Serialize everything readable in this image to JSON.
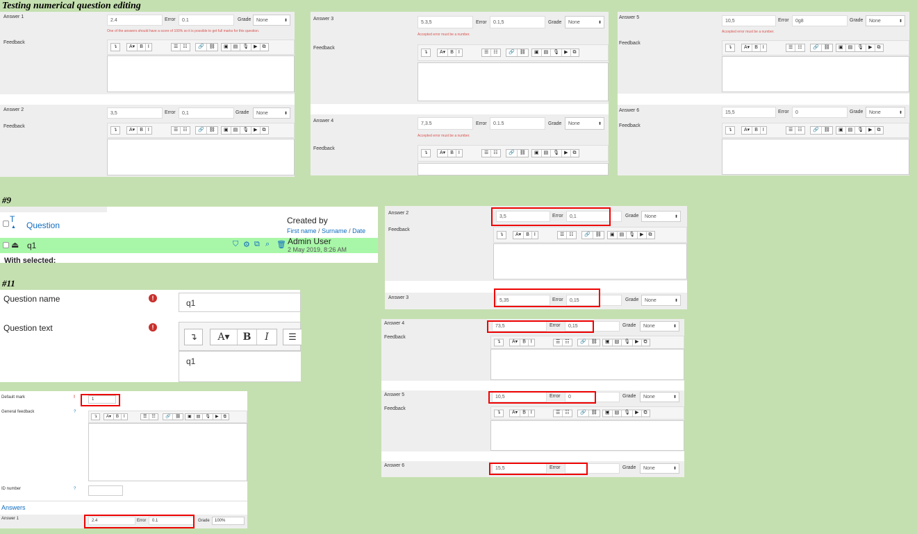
{
  "headings": {
    "main": "Testing numerical question editing",
    "h9": "#9",
    "h11": "#11"
  },
  "field_labels": {
    "error": "Error",
    "grade": "Grade",
    "feedback": "Feedback",
    "grade_none": "None",
    "grade_100": "100%"
  },
  "messages": {
    "score_warning": "One of the answers should have a score of 100% so it is possible to get full marks for this question.",
    "error_number": "Accepted error must be a number."
  },
  "toolbar": {
    "g1": [
      "↴"
    ],
    "g2": [
      "A▾",
      "B",
      "I"
    ],
    "g3": [
      "☰",
      "☷"
    ],
    "g4": [
      "🔗",
      "⛓"
    ],
    "g5": [
      "▣",
      "▤",
      "🎙",
      "▶",
      "⧉"
    ]
  },
  "panel_a": {
    "answer1": {
      "label": "Answer 1",
      "value": "2.4",
      "error": "0.1"
    },
    "answer2": {
      "label": "Answer 2",
      "value": "3,5",
      "error": "0,1"
    }
  },
  "panel_b": {
    "answer3": {
      "label": "Answer 3",
      "value": "5.3,5",
      "error": "0.1,5"
    },
    "answer4": {
      "label": "Answer 4",
      "value": "7,3.5",
      "error": "0.1.5"
    }
  },
  "panel_c": {
    "answer5": {
      "label": "Answer 5",
      "value": "10,5",
      "error": "0g8"
    },
    "answer6": {
      "label": "Answer 6",
      "value": "15,5",
      "error": "0"
    }
  },
  "bank": {
    "col_t": "T",
    "col_question": "Question",
    "created_by": "Created by",
    "created_sub": [
      "First name",
      "Surname",
      "Date"
    ],
    "row": {
      "name": "q1",
      "author": "Admin User",
      "date": "2 May 2019, 8:26 AM"
    },
    "with_selected": "With selected:",
    "action_icons": [
      "tag-icon",
      "gear-icon",
      "duplicate-icon",
      "preview-icon",
      "delete-icon"
    ]
  },
  "form11": {
    "qname_label": "Question name",
    "qname_value": "q1",
    "qtext_label": "Question text",
    "qtext_value": "q1"
  },
  "panel_right": {
    "answer2": {
      "label": "Answer 2",
      "value": "3,5",
      "error": "0,1"
    },
    "answer3": {
      "label": "Answer 3",
      "value": "5,35",
      "error": "0,15"
    },
    "answer4": {
      "label": "Answer 4",
      "value": "73,5",
      "error": "0,15"
    },
    "answer5": {
      "label": "Answer 5",
      "value": "10,5",
      "error": "0"
    },
    "answer6": {
      "label": "Answer 6",
      "value": "15,5",
      "error": ""
    }
  },
  "form_bottom": {
    "default_mark_label": "Default mark",
    "default_mark_value": "1",
    "general_feedback_label": "General feedback",
    "id_number_label": "ID number",
    "answers_heading": "Answers",
    "answer1": {
      "label": "Answer 1",
      "value": "2.4",
      "error": "0.1"
    }
  },
  "colors": {
    "page_bg": "#c5e0b0",
    "highlight_row": "#a8f7a8",
    "link": "#0f6cbf",
    "error_text": "#d9534f",
    "red_box": "#e00000"
  }
}
